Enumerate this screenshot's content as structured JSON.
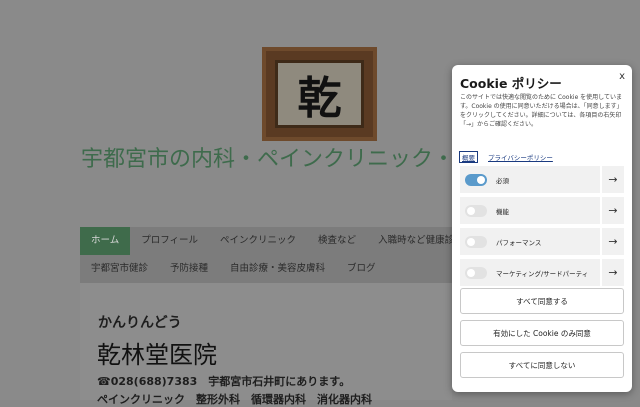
{
  "site": {
    "logo_char": "乾",
    "title": "宇都宮市の内科・ペインクリニック・整形外科",
    "nav_row1": [
      "ホーム",
      "プロフィール",
      "ペインクリニック",
      "検査など",
      "入職時など健康診断"
    ],
    "nav_row2": [
      "宇都宮市健診",
      "予防接種",
      "自由診療・美容皮膚科",
      "ブログ"
    ],
    "kana": "かんりんどう",
    "clinic_name": "乾林堂医院",
    "tel_line": "☎028(688)7383　宇都宮市石井町にあります。",
    "depts_line": "ペインクリニック　整形外科　循環器内科　消化器内科"
  },
  "cookie": {
    "title": "Cookie ポリシー",
    "close": "x",
    "description": "このサイトでは快適な閲覧のために Cookie を使用しています。Cookie の使用に同意いただける場合は、「同意します」をクリックしてください。詳細については、各項目の右矢印「→」からご確認ください。",
    "overview_tab": "概要",
    "privacy_link": "プライバシーポリシー",
    "categories": [
      {
        "label": "必須",
        "enabled": true
      },
      {
        "label": "機能",
        "enabled": false
      },
      {
        "label": "パフォーマンス",
        "enabled": false
      },
      {
        "label": "マーケティング/サードパーティ",
        "enabled": false
      }
    ],
    "arrow_glyph": "→",
    "accept_all": "すべて同意する",
    "accept_enabled": "有効にした Cookie のみ同意",
    "reject_all": "すべてに同意しない"
  }
}
